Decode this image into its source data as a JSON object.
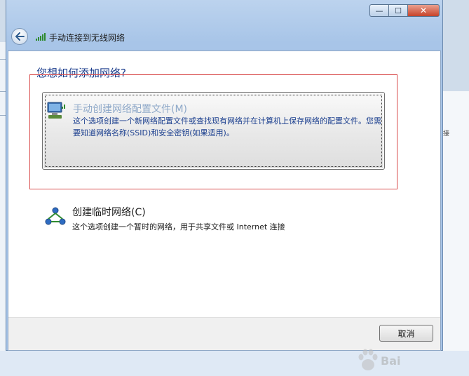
{
  "window": {
    "title": "手动连接到无线网络",
    "caption_buttons": {
      "minimize": "—",
      "maximize": "☐",
      "close": "✕"
    }
  },
  "main": {
    "question": "您想如何添加网络?",
    "options": [
      {
        "title": "手动创建网络配置文件(M)",
        "description": "这个选项创建一个新网络配置文件或查找现有网络并在计算机上保存网络的配置文件。您需要知道网络名称(SSID)和安全密钥(如果适用)。",
        "icon": "wireless-computer-icon"
      },
      {
        "title": "创建临时网络(C)",
        "description": "这个选项创建一个暂时的网络，用于共享文件或 Internet 连接",
        "icon": "adhoc-network-icon"
      }
    ]
  },
  "footer": {
    "cancel_label": "取消"
  },
  "background": {
    "right_text": "接"
  },
  "watermark": {
    "text": "Bai"
  },
  "colors": {
    "accent_blue": "#1b3c8c",
    "annotation_red": "#d94f4f",
    "disabled_title": "#8fa9c9"
  }
}
